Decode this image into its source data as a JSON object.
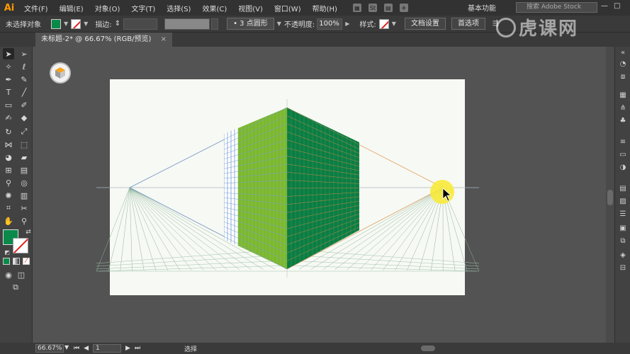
{
  "app": {
    "logo": "Ai"
  },
  "menu": [
    "文件(F)",
    "编辑(E)",
    "对象(O)",
    "文字(T)",
    "选择(S)",
    "效果(C)",
    "视图(V)",
    "窗口(W)",
    "帮助(H)"
  ],
  "menubar_icons": [
    "bridge-icon",
    "stock-icon",
    "arrange-documents-icon",
    "gpu-icon"
  ],
  "menubar_icon_labels": {
    "stock": "St"
  },
  "workspace": {
    "label": "基本功能"
  },
  "stock_search": {
    "placeholder": "搜索 Adobe Stock"
  },
  "window_controls": {
    "minimize": "—",
    "maximize": "□",
    "close": "×"
  },
  "controlbar": {
    "selection": "未选择对象",
    "stroke_label": "描边:",
    "brush_label": "3 点圆形",
    "opacity_label": "不透明度:",
    "opacity_value": "100%",
    "style_label": "样式:",
    "doc_setup": "文档设置",
    "preferences": "首选项"
  },
  "colors": {
    "fill": "#0a8a4a",
    "stroke": "none",
    "accent_ai": "#ff9a00"
  },
  "document_tab": {
    "title": "未标题-2* @ 66.67% (RGB/预览)",
    "close": "×"
  },
  "tools": [
    "selection-tool",
    "direct-selection-tool",
    "magic-wand-tool",
    "lasso-tool",
    "pen-tool",
    "curvature-tool",
    "type-tool",
    "line-tool",
    "rectangle-tool",
    "paintbrush-tool",
    "shaper-tool",
    "eraser-tool",
    "rotate-tool",
    "scale-tool",
    "width-tool",
    "free-transform-tool",
    "shape-builder-tool",
    "perspective-grid-tool",
    "mesh-tool",
    "gradient-tool",
    "eyedropper-tool",
    "blend-tool",
    "symbol-sprayer-tool",
    "column-graph-tool",
    "artboard-tool",
    "slice-tool",
    "hand-tool",
    "zoom-tool"
  ],
  "statusbar": {
    "zoom": "66.67%",
    "artboard": "1",
    "status": "选择"
  },
  "watermark": {
    "text": "虎课网"
  }
}
